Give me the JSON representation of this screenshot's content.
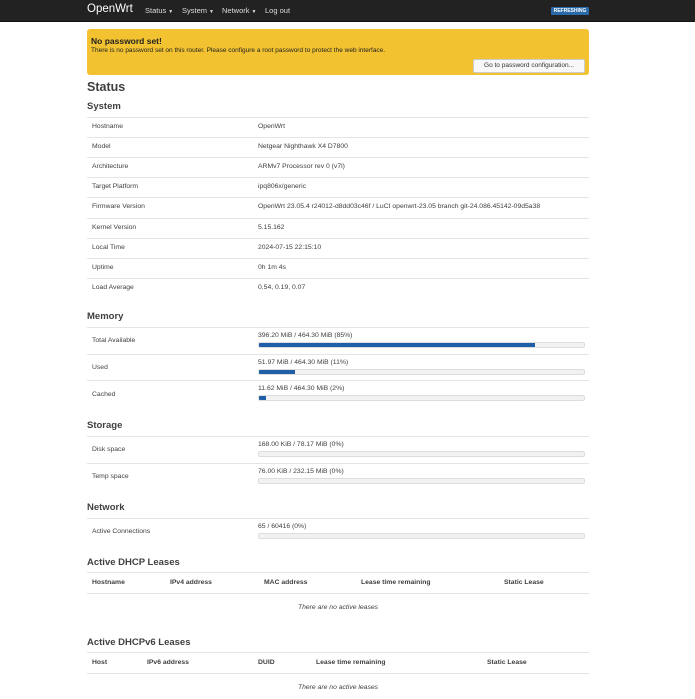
{
  "navbar": {
    "brand": "OpenWrt",
    "menu": [
      "Status",
      "System",
      "Network"
    ],
    "logout": "Log out",
    "refreshing": "REFRESHING"
  },
  "alert": {
    "title": "No password set!",
    "text": "There is no password set on this router. Please configure a root password to protect the web interface.",
    "button": "Go to password configuration..."
  },
  "page_title": "Status",
  "system": {
    "heading": "System",
    "rows": [
      {
        "label": "Hostname",
        "value": "OpenWrt"
      },
      {
        "label": "Model",
        "value": "Netgear Nighthawk X4 D7800"
      },
      {
        "label": "Architecture",
        "value": "ARMv7 Processor rev 0 (v7l)"
      },
      {
        "label": "Target Platform",
        "value": "ipq806x/generic"
      },
      {
        "label": "Firmware Version",
        "value": "OpenWrt 23.05.4 r24012-d8dd03c46f / LuCI openwrt-23.05 branch git-24.086.45142-09d5a38"
      },
      {
        "label": "Kernel Version",
        "value": "5.15.162"
      },
      {
        "label": "Local Time",
        "value": "2024-07-15 22:15:10"
      },
      {
        "label": "Uptime",
        "value": "0h 1m 4s"
      },
      {
        "label": "Load Average",
        "value": "0.54, 0.19, 0.07"
      }
    ]
  },
  "memory": {
    "heading": "Memory",
    "rows": [
      {
        "label": "Total Available",
        "value": "396.20 MiB / 464.30 MiB (85%)",
        "percent": 85
      },
      {
        "label": "Used",
        "value": "51.97 MiB / 464.30 MiB (11%)",
        "percent": 11
      },
      {
        "label": "Cached",
        "value": "11.62 MiB / 464.30 MiB (2%)",
        "percent": 2
      }
    ]
  },
  "storage": {
    "heading": "Storage",
    "rows": [
      {
        "label": "Disk space",
        "value": "168.00 KiB / 78.17 MiB (0%)",
        "percent": 0
      },
      {
        "label": "Temp space",
        "value": "76.00 KiB / 232.15 MiB (0%)",
        "percent": 0
      }
    ]
  },
  "network": {
    "heading": "Network",
    "rows": [
      {
        "label": "Active Connections",
        "value": "65 / 60416 (0%)",
        "percent": 0
      }
    ]
  },
  "dhcp": {
    "heading": "Active DHCP Leases",
    "columns": [
      "Hostname",
      "IPv4 address",
      "MAC address",
      "Lease time remaining",
      "Static Lease"
    ],
    "empty": "There are no active leases"
  },
  "dhcp6": {
    "heading": "Active DHCPv6 Leases",
    "columns": [
      "Host",
      "IPv6 address",
      "DUID",
      "Lease time remaining",
      "Static Lease"
    ],
    "empty": "There are no active leases"
  },
  "colors": {
    "accent": "#1e5fa8",
    "warning": "#f2c230",
    "navbar": "#222222"
  }
}
